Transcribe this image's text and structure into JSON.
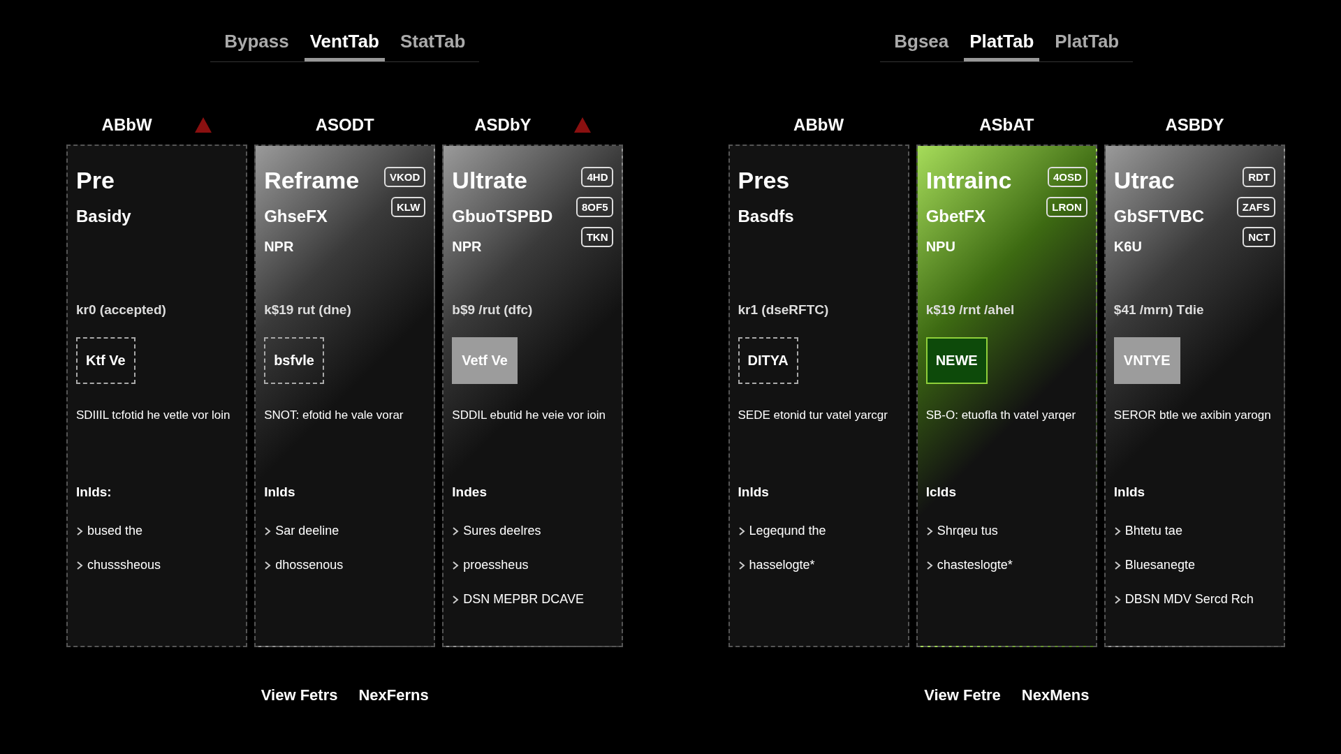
{
  "panels": [
    {
      "tabs": [
        {
          "label": "Bypass",
          "selected": false
        },
        {
          "label": "VentTab",
          "selected": true
        },
        {
          "label": "StatTab",
          "selected": false
        }
      ],
      "plans": [
        {
          "header": "ABbW",
          "warning": true,
          "kind": "plain",
          "title": "Pre",
          "subtitle": "Basidy",
          "price": "kr0 (accepted)",
          "button": {
            "label": "Ktf Ve",
            "kind": "outline"
          },
          "description": "SDIIIL tcfotid he vetle vor loin",
          "includes": "Inlds:",
          "features": [
            "bused the",
            "chusssheous"
          ]
        },
        {
          "header": "ASODT",
          "warning": false,
          "kind": "grey",
          "title": "Reframe",
          "subtitle": "GhseFX",
          "badges": [
            "VKOD",
            "KLW"
          ],
          "unit": "NPR",
          "price": "k$19 rut (dne)",
          "button": {
            "label": "bsfvle",
            "kind": "outline"
          },
          "description": "SNOT: efotid he vale vorar",
          "includes": "Inlds",
          "features": [
            "Sar deeline",
            "dhossenous"
          ]
        },
        {
          "header": "ASDbY",
          "warning": true,
          "kind": "grey",
          "title": "Ultrate",
          "subtitle": "GbuoTSPBD",
          "badges": [
            "4HD",
            "8OF5",
            "TKN"
          ],
          "unit": "NPR",
          "price": "b$9 /rut (dfc)",
          "button": {
            "label": "Vetf Ve",
            "kind": "filled"
          },
          "description": "SDDIL ebutid he veie vor ioin",
          "includes": "Indes",
          "features": [
            "Sures deelres",
            "proessheus",
            "DSN MEPBR DCAVE"
          ]
        }
      ],
      "links": [
        "View Fetrs",
        "NexFerns"
      ]
    },
    {
      "tabs": [
        {
          "label": "Bgsea",
          "selected": false
        },
        {
          "label": "PlatTab",
          "selected": true
        },
        {
          "label": "PlatTab",
          "selected": false
        }
      ],
      "plans": [
        {
          "header": "ABbW",
          "warning": false,
          "kind": "plain",
          "title": "Pres",
          "subtitle": "Basdfs",
          "price": "kr1 (dseRFTC)",
          "button": {
            "label": "DITYA",
            "kind": "outline"
          },
          "description": "SEDE etonid tur vatel yarcgr",
          "includes": "Inlds",
          "features": [
            "Legeqund the",
            "hasselogte*"
          ]
        },
        {
          "header": "ASbAT",
          "warning": false,
          "kind": "green",
          "title": "Intrainc",
          "subtitle": "GbetFX",
          "badges": [
            "4OSD",
            "LRON"
          ],
          "unit": "NPU",
          "price": "k$19 /rnt /ahel",
          "button": {
            "label": "NEWE",
            "kind": "green"
          },
          "description": "SB-O: etuofla th vatel yarqer",
          "includes": "Iclds",
          "features": [
            "Shrqeu tus",
            "chasteslogte*"
          ]
        },
        {
          "header": "ASBDY",
          "warning": false,
          "kind": "grey",
          "title": "Utrac",
          "subtitle": "GbSFTVBC",
          "badges": [
            "RDT",
            "ZAFS",
            "NCT"
          ],
          "unit": "K6U",
          "price": "$41 /mrn) Tdie",
          "button": {
            "label": "VNTYE",
            "kind": "filled"
          },
          "description": "SEROR btle we axibin yarogn",
          "includes": "Inlds",
          "features": [
            "Bhtetu tae",
            "Bluesanegte",
            "DBSN MDV Sercd Rch"
          ]
        }
      ],
      "links": [
        "View Fetre",
        "NexMens"
      ]
    }
  ]
}
